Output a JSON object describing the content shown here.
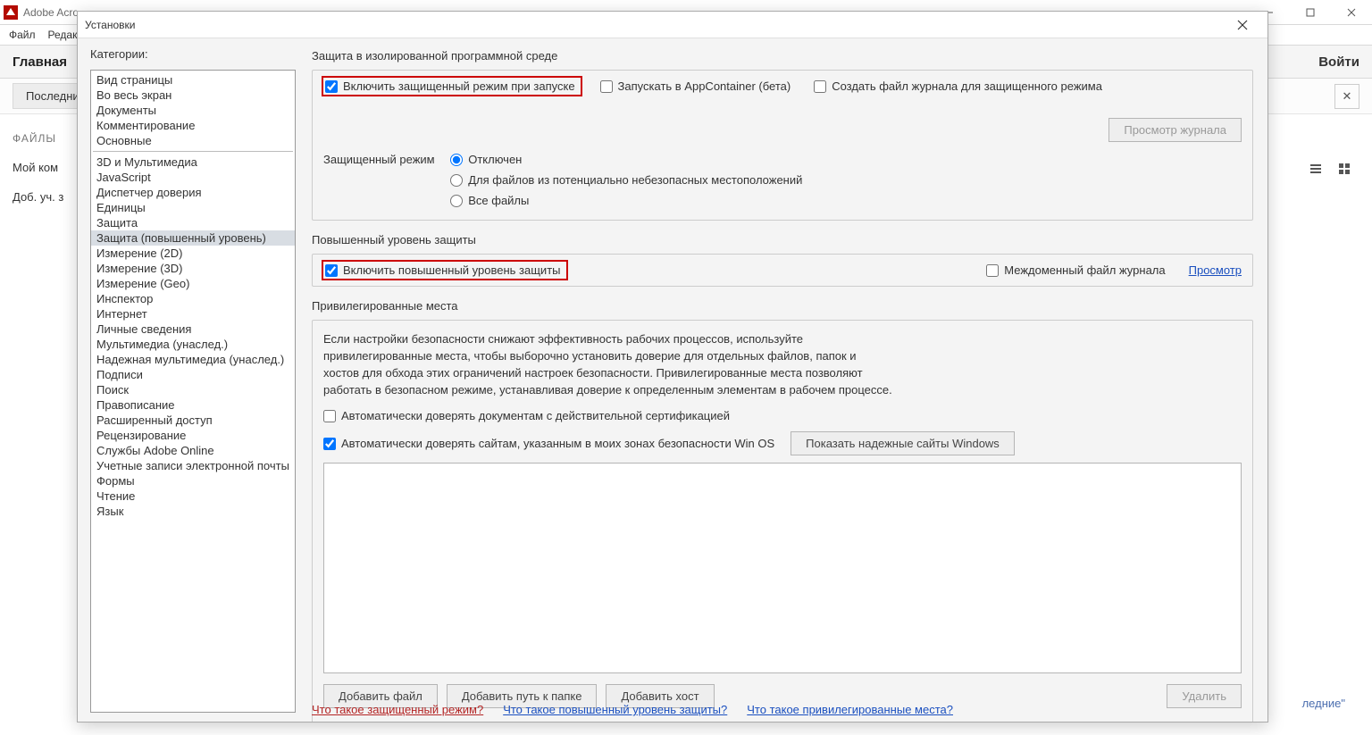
{
  "app": {
    "title": "Adobe Acro",
    "menubar": [
      "Файл",
      "Редакти"
    ],
    "tabs": {
      "main": "Главная",
      "right": "Войти"
    },
    "toolbar": {
      "recent": "Последни"
    },
    "side": {
      "files": "ФАЙЛЫ",
      "my_computer": "Мой ком",
      "add_account": "Доб. уч. з"
    },
    "bg_hint": "ледние\""
  },
  "dialog": {
    "title": "Установки",
    "categories_label": "Категории:",
    "categories_top": [
      "Вид страницы",
      "Во весь экран",
      "Документы",
      "Комментирование",
      "Основные"
    ],
    "categories_rest": [
      "3D и Мультимедиа",
      "JavaScript",
      "Диспетчер доверия",
      "Единицы",
      "Защита",
      "Защита (повышенный уровень)",
      "Измерение (2D)",
      "Измерение (3D)",
      "Измерение (Geo)",
      "Инспектор",
      "Интернет",
      "Личные сведения",
      "Мультимедиа (унаслед.)",
      "Надежная мультимедиа (унаслед.)",
      "Подписи",
      "Поиск",
      "Правописание",
      "Расширенный доступ",
      "Рецензирование",
      "Службы Adobe Online",
      "Учетные записи электронной почты",
      "Формы",
      "Чтение",
      "Язык"
    ],
    "selected_category": "Защита (повышенный уровень)",
    "sandbox": {
      "title": "Защита в изолированной программной среде",
      "enable_protected": "Включить защищенный режим при запуске",
      "appcontainer": "Запускать в AppContainer (бета)",
      "create_log": "Создать файл журнала для защищенного режима",
      "view_log_btn": "Просмотр журнала",
      "mode_label": "Защищенный режим",
      "radio_off": "Отключен",
      "radio_unsafe": "Для файлов из потенциально небезопасных местоположений",
      "radio_all": "Все файлы"
    },
    "enhanced": {
      "title": "Повышенный уровень защиты",
      "enable": "Включить повышенный уровень защиты",
      "cross_domain": "Междоменный файл журнала",
      "view": "Просмотр"
    },
    "priv": {
      "title": "Привилегированные места",
      "desc": "Если настройки безопасности снижают эффективность рабочих процессов, используйте привилегированные места, чтобы выборочно установить доверие для отдельных файлов, папок и хостов для обхода этих ограничений настроек безопасности. Привилегированные места позволяют работать в безопасном режиме, устанавливая доверие к определенным элементам в рабочем процессе.",
      "trust_cert": "Автоматически доверять документам с действительной сертификацией",
      "trust_win": "Автоматически доверять сайтам, указанным в моих зонах безопасности Win OS",
      "show_win_btn": "Показать надежные сайты Windows",
      "add_file": "Добавить файл",
      "add_folder": "Добавить путь к папке",
      "add_host": "Добавить хост",
      "delete": "Удалить"
    },
    "links": {
      "what_protected": "Что такое защищенный режим?",
      "what_enhanced": "Что такое повышенный уровень защиты?",
      "what_priv": "Что такое привилегированные места?"
    }
  }
}
